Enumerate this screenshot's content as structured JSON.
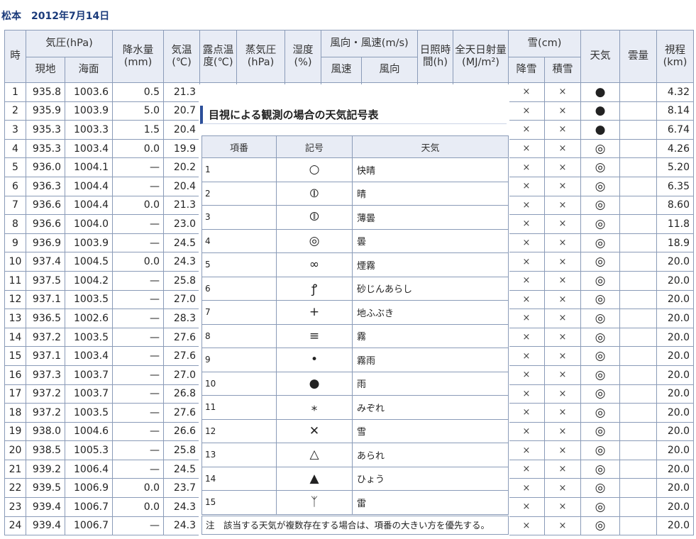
{
  "header": {
    "station": "松本",
    "date": "2012年7月14日"
  },
  "columns": {
    "hour": "時",
    "pressure": "気圧(hPa)",
    "pressure_local": "現地",
    "pressure_sea": "海面",
    "precip": "降水量(mm)",
    "temp": "気温(℃)",
    "dew": "露点温度(℃)",
    "vapor": "蒸気圧(hPa)",
    "humidity": "湿度(%)",
    "wind": "風向・風速(m/s)",
    "wind_speed": "風速",
    "wind_dir": "風向",
    "sunshine": "日照時間(h)",
    "radiation": "全天日射量(MJ/m²)",
    "snow": "雪(cm)",
    "snowfall": "降雪",
    "snow_depth": "積雪",
    "weather": "天気",
    "cloud": "雲量",
    "visibility": "視程(km)"
  },
  "rows": [
    {
      "h": "1",
      "pl": "935.8",
      "ps": "1003.6",
      "pr": "0.5",
      "t": "21.3",
      "sf": "×",
      "sd": "×",
      "w": "●",
      "v": "4.32"
    },
    {
      "h": "2",
      "pl": "935.9",
      "ps": "1003.9",
      "pr": "5.0",
      "t": "20.7",
      "sf": "×",
      "sd": "×",
      "w": "●",
      "v": "8.14"
    },
    {
      "h": "3",
      "pl": "935.3",
      "ps": "1003.3",
      "pr": "1.5",
      "t": "20.4",
      "sf": "×",
      "sd": "×",
      "w": "●",
      "v": "6.74"
    },
    {
      "h": "4",
      "pl": "935.3",
      "ps": "1003.4",
      "pr": "0.0",
      "t": "19.9",
      "sf": "×",
      "sd": "×",
      "w": "◎",
      "v": "4.26"
    },
    {
      "h": "5",
      "pl": "936.0",
      "ps": "1004.1",
      "pr": "—",
      "t": "20.2",
      "sf": "×",
      "sd": "×",
      "w": "◎",
      "v": "5.20"
    },
    {
      "h": "6",
      "pl": "936.3",
      "ps": "1004.4",
      "pr": "—",
      "t": "20.4",
      "sf": "×",
      "sd": "×",
      "w": "◎",
      "v": "6.35"
    },
    {
      "h": "7",
      "pl": "936.6",
      "ps": "1004.4",
      "pr": "0.0",
      "t": "21.3",
      "sf": "×",
      "sd": "×",
      "w": "◎",
      "v": "8.60"
    },
    {
      "h": "8",
      "pl": "936.6",
      "ps": "1004.0",
      "pr": "—",
      "t": "23.0",
      "sf": "×",
      "sd": "×",
      "w": "◎",
      "v": "11.8"
    },
    {
      "h": "9",
      "pl": "936.9",
      "ps": "1003.9",
      "pr": "—",
      "t": "24.5",
      "sf": "×",
      "sd": "×",
      "w": "◎",
      "v": "18.9"
    },
    {
      "h": "10",
      "pl": "937.4",
      "ps": "1004.5",
      "pr": "0.0",
      "t": "24.3",
      "sf": "×",
      "sd": "×",
      "w": "◎",
      "v": "20.0"
    },
    {
      "h": "11",
      "pl": "937.5",
      "ps": "1004.2",
      "pr": "—",
      "t": "25.8",
      "sf": "×",
      "sd": "×",
      "w": "◎",
      "v": "20.0"
    },
    {
      "h": "12",
      "pl": "937.1",
      "ps": "1003.5",
      "pr": "—",
      "t": "27.0",
      "sf": "×",
      "sd": "×",
      "w": "◎",
      "v": "20.0"
    },
    {
      "h": "13",
      "pl": "936.5",
      "ps": "1002.6",
      "pr": "—",
      "t": "28.3",
      "sf": "×",
      "sd": "×",
      "w": "◎",
      "v": "20.0"
    },
    {
      "h": "14",
      "pl": "937.2",
      "ps": "1003.5",
      "pr": "—",
      "t": "27.6",
      "sf": "×",
      "sd": "×",
      "w": "◎",
      "v": "20.0"
    },
    {
      "h": "15",
      "pl": "937.1",
      "ps": "1003.4",
      "pr": "—",
      "t": "27.6",
      "sf": "×",
      "sd": "×",
      "w": "◎",
      "v": "20.0"
    },
    {
      "h": "16",
      "pl": "937.3",
      "ps": "1003.7",
      "pr": "—",
      "t": "27.0",
      "sf": "×",
      "sd": "×",
      "w": "◎",
      "v": "20.0"
    },
    {
      "h": "17",
      "pl": "937.2",
      "ps": "1003.7",
      "pr": "—",
      "t": "26.8",
      "sf": "×",
      "sd": "×",
      "w": "◎",
      "v": "20.0"
    },
    {
      "h": "18",
      "pl": "937.2",
      "ps": "1003.5",
      "pr": "—",
      "t": "27.6",
      "sf": "×",
      "sd": "×",
      "w": "◎",
      "v": "20.0"
    },
    {
      "h": "19",
      "pl": "938.0",
      "ps": "1004.6",
      "pr": "—",
      "t": "26.6",
      "sf": "×",
      "sd": "×",
      "w": "◎",
      "v": "20.0"
    },
    {
      "h": "20",
      "pl": "938.5",
      "ps": "1005.3",
      "pr": "—",
      "t": "25.8",
      "sf": "×",
      "sd": "×",
      "w": "◎",
      "v": "20.0"
    },
    {
      "h": "21",
      "pl": "939.2",
      "ps": "1006.4",
      "pr": "—",
      "t": "24.5",
      "sf": "×",
      "sd": "×",
      "w": "◎",
      "v": "20.0"
    },
    {
      "h": "22",
      "pl": "939.5",
      "ps": "1006.9",
      "pr": "0.0",
      "t": "23.7",
      "sf": "×",
      "sd": "×",
      "w": "◎",
      "v": "20.0"
    },
    {
      "h": "23",
      "pl": "939.4",
      "ps": "1006.7",
      "pr": "0.0",
      "t": "24.3",
      "sf": "×",
      "sd": "×",
      "w": "◎",
      "v": "20.0"
    },
    {
      "h": "24",
      "pl": "939.4",
      "ps": "1006.7",
      "pr": "—",
      "t": "24.3",
      "sf": "×",
      "sd": "×",
      "w": "◎",
      "v": "20.0"
    }
  ],
  "legend": {
    "title": "目視による観測の場合の天気記号表",
    "col_no": "項番",
    "col_symbol": "記号",
    "col_weather": "天気",
    "items": [
      {
        "no": "1",
        "sym": "○",
        "name": "快晴"
      },
      {
        "no": "2",
        "sym": "⦶",
        "name": "晴"
      },
      {
        "no": "3",
        "sym": "⦷",
        "name": "薄曇"
      },
      {
        "no": "4",
        "sym": "◎",
        "name": "曇"
      },
      {
        "no": "5",
        "sym": "∞",
        "name": "煙霧"
      },
      {
        "no": "6",
        "sym": "ꝭ",
        "name": "砂じんあらし"
      },
      {
        "no": "7",
        "sym": "+",
        "name": "地ふぶき"
      },
      {
        "no": "8",
        "sym": "≡",
        "name": "霧"
      },
      {
        "no": "9",
        "sym": "•",
        "name": "霧雨"
      },
      {
        "no": "10",
        "sym": "●",
        "name": "雨"
      },
      {
        "no": "11",
        "sym": "⁎",
        "name": "みぞれ"
      },
      {
        "no": "12",
        "sym": "✕",
        "name": "雪"
      },
      {
        "no": "13",
        "sym": "△",
        "name": "あられ"
      },
      {
        "no": "14",
        "sym": "▲",
        "name": "ひょう"
      },
      {
        "no": "15",
        "sym": "ᛉ",
        "name": "雷"
      }
    ],
    "note": "注　該当する天気が複数存在する場合は、項番の大きい方を優先する。"
  }
}
